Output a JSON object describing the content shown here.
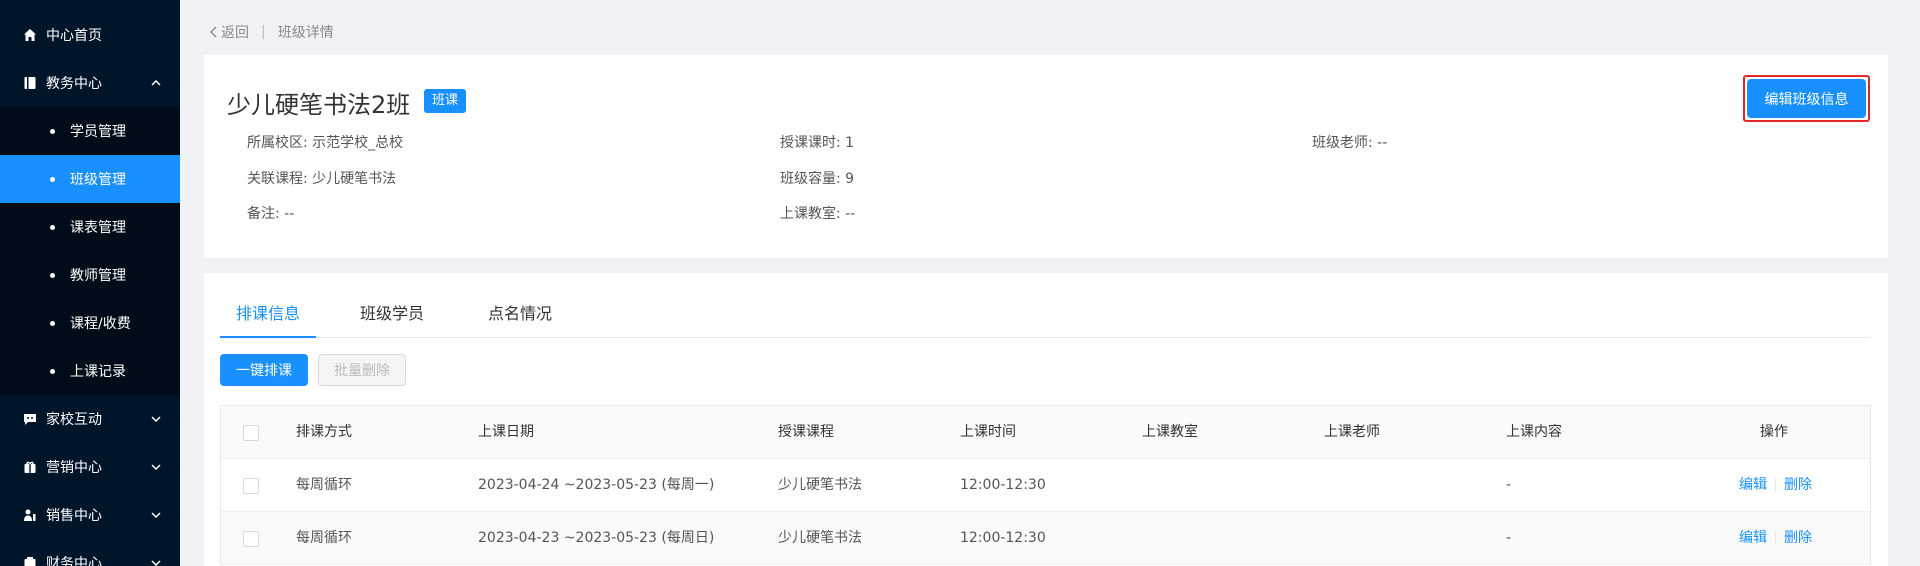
{
  "sidebar": {
    "home": {
      "label": "中心首页",
      "icon": "home-icon"
    },
    "academic": {
      "label": "教务中心",
      "icon": "book-icon"
    },
    "academic_items": [
      {
        "label": "学员管理"
      },
      {
        "label": "班级管理",
        "active": true
      },
      {
        "label": "课表管理"
      },
      {
        "label": "教师管理"
      },
      {
        "label": "课程/收费"
      },
      {
        "label": "上课记录"
      }
    ],
    "home_school": {
      "label": "家校互动",
      "icon": "chat-icon"
    },
    "marketing": {
      "label": "营销中心",
      "icon": "gift-icon"
    },
    "sales": {
      "label": "销售中心",
      "icon": "sales-icon"
    },
    "finance": {
      "label": "财务中心",
      "icon": "finance-icon"
    }
  },
  "breadcrumb": {
    "back": "返回",
    "current": "班级详情"
  },
  "class_info": {
    "title": "少儿硬笔书法2班",
    "tag": "班课",
    "edit_button": "编辑班级信息",
    "campus": "所属校区: 示范学校_总校",
    "course": "关联课程: 少儿硬笔书法",
    "remark": "备注: --",
    "hours": "授课课时: 1",
    "capacity": "班级容量: 9",
    "classroom": "上课教室: --",
    "teacher": "班级老师: --"
  },
  "tabs": [
    "排课信息",
    "班级学员",
    "点名情况"
  ],
  "actions": {
    "schedule": "一键排课",
    "batch_delete": "批量删除"
  },
  "table": {
    "headers": [
      "排课方式",
      "上课日期",
      "授课课程",
      "上课时间",
      "上课教室",
      "上课老师",
      "上课内容",
      "操作"
    ],
    "rows": [
      {
        "mode": "每周循环",
        "date": "2023-04-24 ~2023-05-23 (每周一)",
        "course": "少儿硬笔书法",
        "time": "12:00-12:30",
        "room": "",
        "teacher": "",
        "content": "-",
        "edit": "编辑",
        "delete": "删除"
      },
      {
        "mode": "每周循环",
        "date": "2023-04-23 ~2023-05-23 (每周日)",
        "course": "少儿硬笔书法",
        "time": "12:00-12:30",
        "room": "",
        "teacher": "",
        "content": "-",
        "edit": "编辑",
        "delete": "删除"
      }
    ]
  },
  "colors": {
    "sidebar_bg": "#001529",
    "primary": "#1890ff",
    "highlight_border": "#e0282a"
  }
}
